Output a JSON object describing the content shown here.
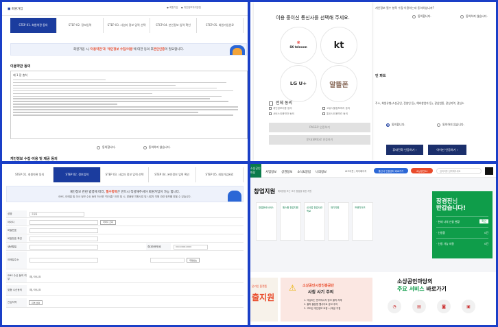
{
  "pane1": {
    "step_labels": [
      "STEP 01. 회원약관 동의",
      "STEP 02. 정보입력",
      "STEP 03. 사업자 정보 입력 선택",
      "STEP 04. 본인정보 입력 확인",
      "STEP 05. 회원가입완료"
    ],
    "notice_pre": "회원가입 시, ",
    "notice_hl": "'이용약관'과 '개인정보 수집/이용'",
    "notice_post": "에 대한 동의 후 ",
    "notice_hl2": "본인인증",
    "notice_end": "이 필요합니다.",
    "terms_heading": "이용약관 동의",
    "terms_chapter": "제 1 장 총칙",
    "agree": "동의합니다.",
    "disagree": "동의하지 않습니다.",
    "privacy_heading": "개인정보 수집·이용 및 제공 동의"
  },
  "pane2": {
    "modal_title": "이용 중이신 통신사를 선택해 주세요.",
    "carriers": [
      "SK telecom",
      "kt",
      "LG U+",
      "알뜰폰"
    ],
    "check_all": "전체 동의",
    "agree_items": [
      "개인정보이용 동의",
      "고유식별정보처리 동의",
      "서비스이용약관 동의",
      "통신사이용약관 동의"
    ],
    "btn_pass": "PASS로 인증하기",
    "btn_sms": "문자(SMS)로 인증하기",
    "side_text_top": "개인정보 필수 항목 수집·이용하는데 동의하십니까?",
    "side_section": "인 파트",
    "side_note": "주소, 회원유형(소상공인, 전설인 등), 예비창업자 등), 관심업종, 관심지역, 관심소",
    "agree": "동의합니다.",
    "disagree": "동의하지 않습니다.",
    "btn_phone": "휴대전화 인증하기",
    "btn_ipin": "아이핀 인증하기"
  },
  "pane3": {
    "step_labels": [
      "STEP 01. 회원약관 동의",
      "STEP 02. 정보입력",
      "STEP 03. 사업자 정보 입력 선택",
      "STEP 04. 본인정보 입력 확인",
      "STEP 05. 회원가입완료"
    ],
    "notice_pre": "개인정보 관련 법령에 따라, ",
    "notice_hl": "필수항목",
    "notice_post": "은 반드시 작성해주셔야 회원가입이 가능 합니다.",
    "notice_line2": "SMS, 이메일 및 이사 정보 수신 동의 하시면 \"마이홈\" 안부 및 시, 맞춤형 지원사업 및 사업자 지원 관련 정보를 받을 수 있습니다.",
    "rows": [
      {
        "label": "성명",
        "value": "홍길동"
      },
      {
        "label": "아이디",
        "value": "",
        "btn": "아이디 조회"
      },
      {
        "label": "비밀번호",
        "value": ""
      },
      {
        "label": "비밀번호 확인",
        "value": ""
      },
      {
        "label": "생년월일",
        "value": "",
        "label2": "휴대전화번호",
        "value2": "010-0000-0000"
      },
      {
        "label": "이메일주소",
        "value": "",
        "btn": "우편번호"
      },
      {
        "label": "SMS 수신 동의 여부",
        "value": "예 / 아니오"
      },
      {
        "label": "맞춤 수신동의",
        "value": "예 / 아니오"
      },
      {
        "label": "관심지역",
        "value": "",
        "btn": "지역 선택"
      }
    ]
  },
  "pane4": {
    "logo_text": "소상공인 마당",
    "gnb": [
      "사업정보",
      "상권정보",
      "소식&알림",
      "나의정보"
    ],
    "login": "로그아웃",
    "mypage": "마이페이지",
    "pill1": "통신사 인증센터 바로가기",
    "pill2": "소상공인24",
    "search_placeholder": "검색어를 입력해주세요",
    "hero_title": "창업지원",
    "hero_sub": "예비창업 또는 초기 창업을 위한 지원",
    "cards": [
      "창업준비서비스",
      "원스톱 창업지원",
      "신사업 창업사관학교",
      "재기지원",
      "프랜차이즈"
    ],
    "greet_name": "장경진",
    "greet_suffix": "님",
    "greet_line2": "반갑습니다!",
    "stat1_label": "· 현재 나의 신청 현황",
    "stat1_btn": "확인",
    "stat2_label": "· 신청중",
    "stat2_val": "0건",
    "stat3_label": "· 신청 가능 지원",
    "stat3_val": "0건",
    "promo1_a": "온라인 플랫폼",
    "promo1_b": "출지원",
    "promo2_a": "소상공인시장진흥공단",
    "promo2_b": "사칭 사기 주의",
    "promo2_items": [
      "1. 의심되는 문자메시지 링크 클릭 자제",
      "2. 출처 불분명 웹사이트 광고 주의",
      "3. 고도된 개인정보 요청 시 제공 거절"
    ],
    "svc_title_a": "소상공인마당의",
    "svc_title_b": "주요 서비스",
    "svc_title_c": "바로가기"
  },
  "colors": {
    "frame": "#1a3fc7",
    "step_active": "#1b3c9e",
    "accent_red": "#e94b2b",
    "navy_btn": "#1b2f6b",
    "brand_green": "#0f9d4a"
  }
}
